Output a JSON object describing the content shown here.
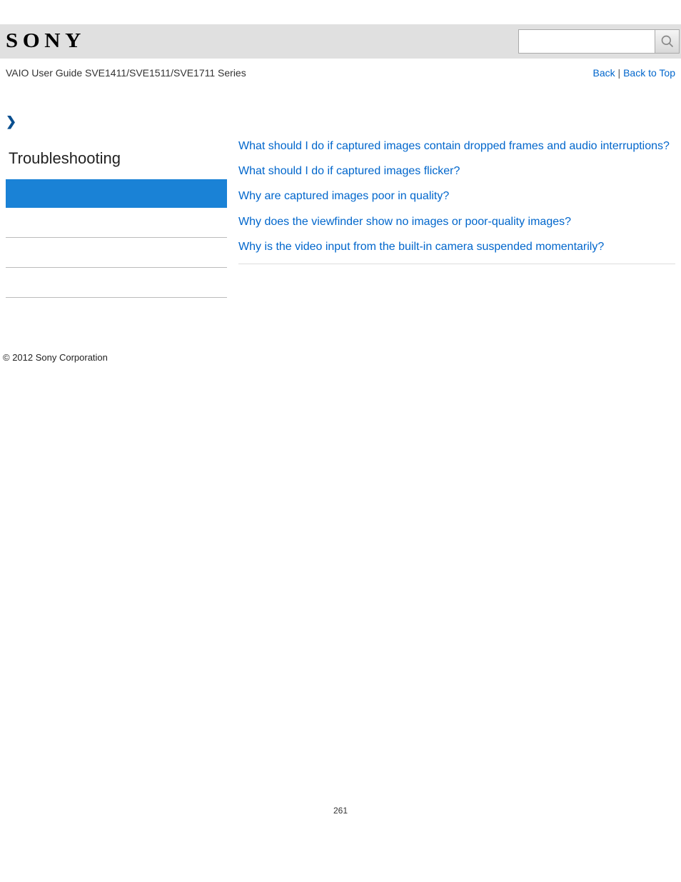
{
  "header": {
    "logo_text": "SONY",
    "search_placeholder": ""
  },
  "subheader": {
    "guide_title": "VAIO User Guide SVE1411/SVE1511/SVE1711 Series",
    "back_label": "Back",
    "separator": " | ",
    "back_to_top_label": "Back to Top"
  },
  "sidebar": {
    "title": "Troubleshooting"
  },
  "content": {
    "links": [
      "What should I do if captured images contain dropped frames and audio interruptions?",
      "What should I do if captured images flicker?",
      "Why are captured images poor in quality?",
      "Why does the viewfinder show no images or poor-quality images?",
      "Why is the video input from the built-in camera suspended momentarily?"
    ]
  },
  "footer": {
    "copyright": "© 2012 Sony Corporation",
    "page_number": "261"
  }
}
